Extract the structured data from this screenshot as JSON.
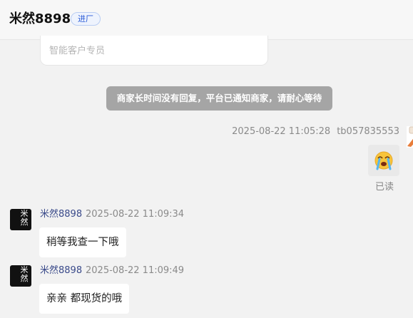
{
  "header": {
    "shop_name": "米然8898",
    "badge": "进厂"
  },
  "card": {
    "text": "智能客户专员"
  },
  "system_notice": "商家长时间没有回复，平台已通知商家，请耐心等待",
  "outgoing": {
    "timestamp": "2025-08-22 11:05:28",
    "user": "tb057835553",
    "emoji": "emoji-crying-face",
    "read_status": "已读"
  },
  "messages": [
    {
      "name": "米然8898",
      "time": "2025-08-22 11:09:34",
      "text": "稍等我查一下哦",
      "avatar_text": "米然"
    },
    {
      "name": "米然8898",
      "time": "2025-08-22 11:09:49",
      "text": "亲亲 都现货的哦",
      "avatar_text": "米然"
    }
  ]
}
